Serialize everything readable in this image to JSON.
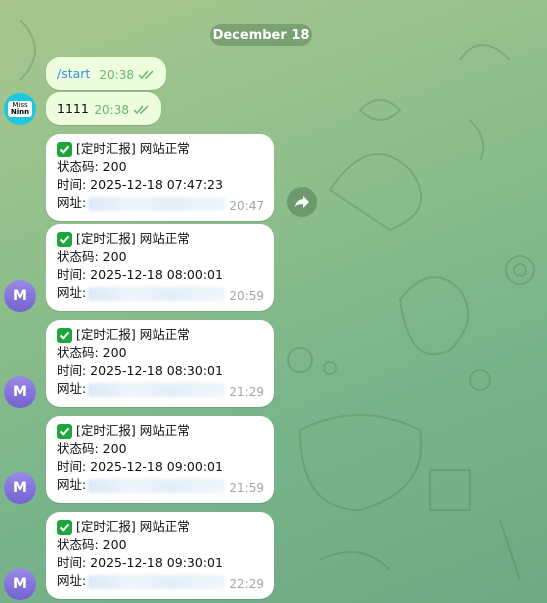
{
  "chat": {
    "date_label": "December 18",
    "outgoing": [
      {
        "text": "/start",
        "time": "20:38",
        "status": "read"
      },
      {
        "text": "1111",
        "time": "20:38",
        "status": "read"
      }
    ],
    "user_avatar": {
      "line1": "Miss",
      "line2": "Ninn"
    },
    "bot_avatar_letter": "M",
    "reports": [
      {
        "title": "[定时汇报] 网站正常",
        "status": "状态码: 200",
        "time_line": "时间: 2025-12-18 07:47:23",
        "url_label": "网址:",
        "time": "20:47"
      },
      {
        "title": "[定时汇报] 网站正常",
        "status": "状态码: 200",
        "time_line": "时间: 2025-12-18 08:00:01",
        "url_label": "网址:",
        "time": "20:59"
      },
      {
        "title": "[定时汇报] 网站正常",
        "status": "状态码: 200",
        "time_line": "时间: 2025-12-18 08:30:01",
        "url_label": "网址:",
        "time": "21:29"
      },
      {
        "title": "[定时汇报] 网站正常",
        "status": "状态码: 200",
        "time_line": "时间: 2025-12-18 09:00:01",
        "url_label": "网址:",
        "time": "21:59"
      },
      {
        "title": "[定时汇报] 网站正常",
        "status": "状态码: 200",
        "time_line": "时间: 2025-12-18 09:30:01",
        "url_label": "网址:",
        "time": "22:29"
      }
    ]
  },
  "colors": {
    "outgoing_bubble": "#eefdde",
    "incoming_bubble": "#ffffff",
    "read_check": "#6ab76a",
    "avatar": "#7f6fd8"
  },
  "icons": {
    "check_mark": "white-check-mark-emoji",
    "forward": "forward-arrow-icon",
    "read_status": "double-check-icon"
  }
}
